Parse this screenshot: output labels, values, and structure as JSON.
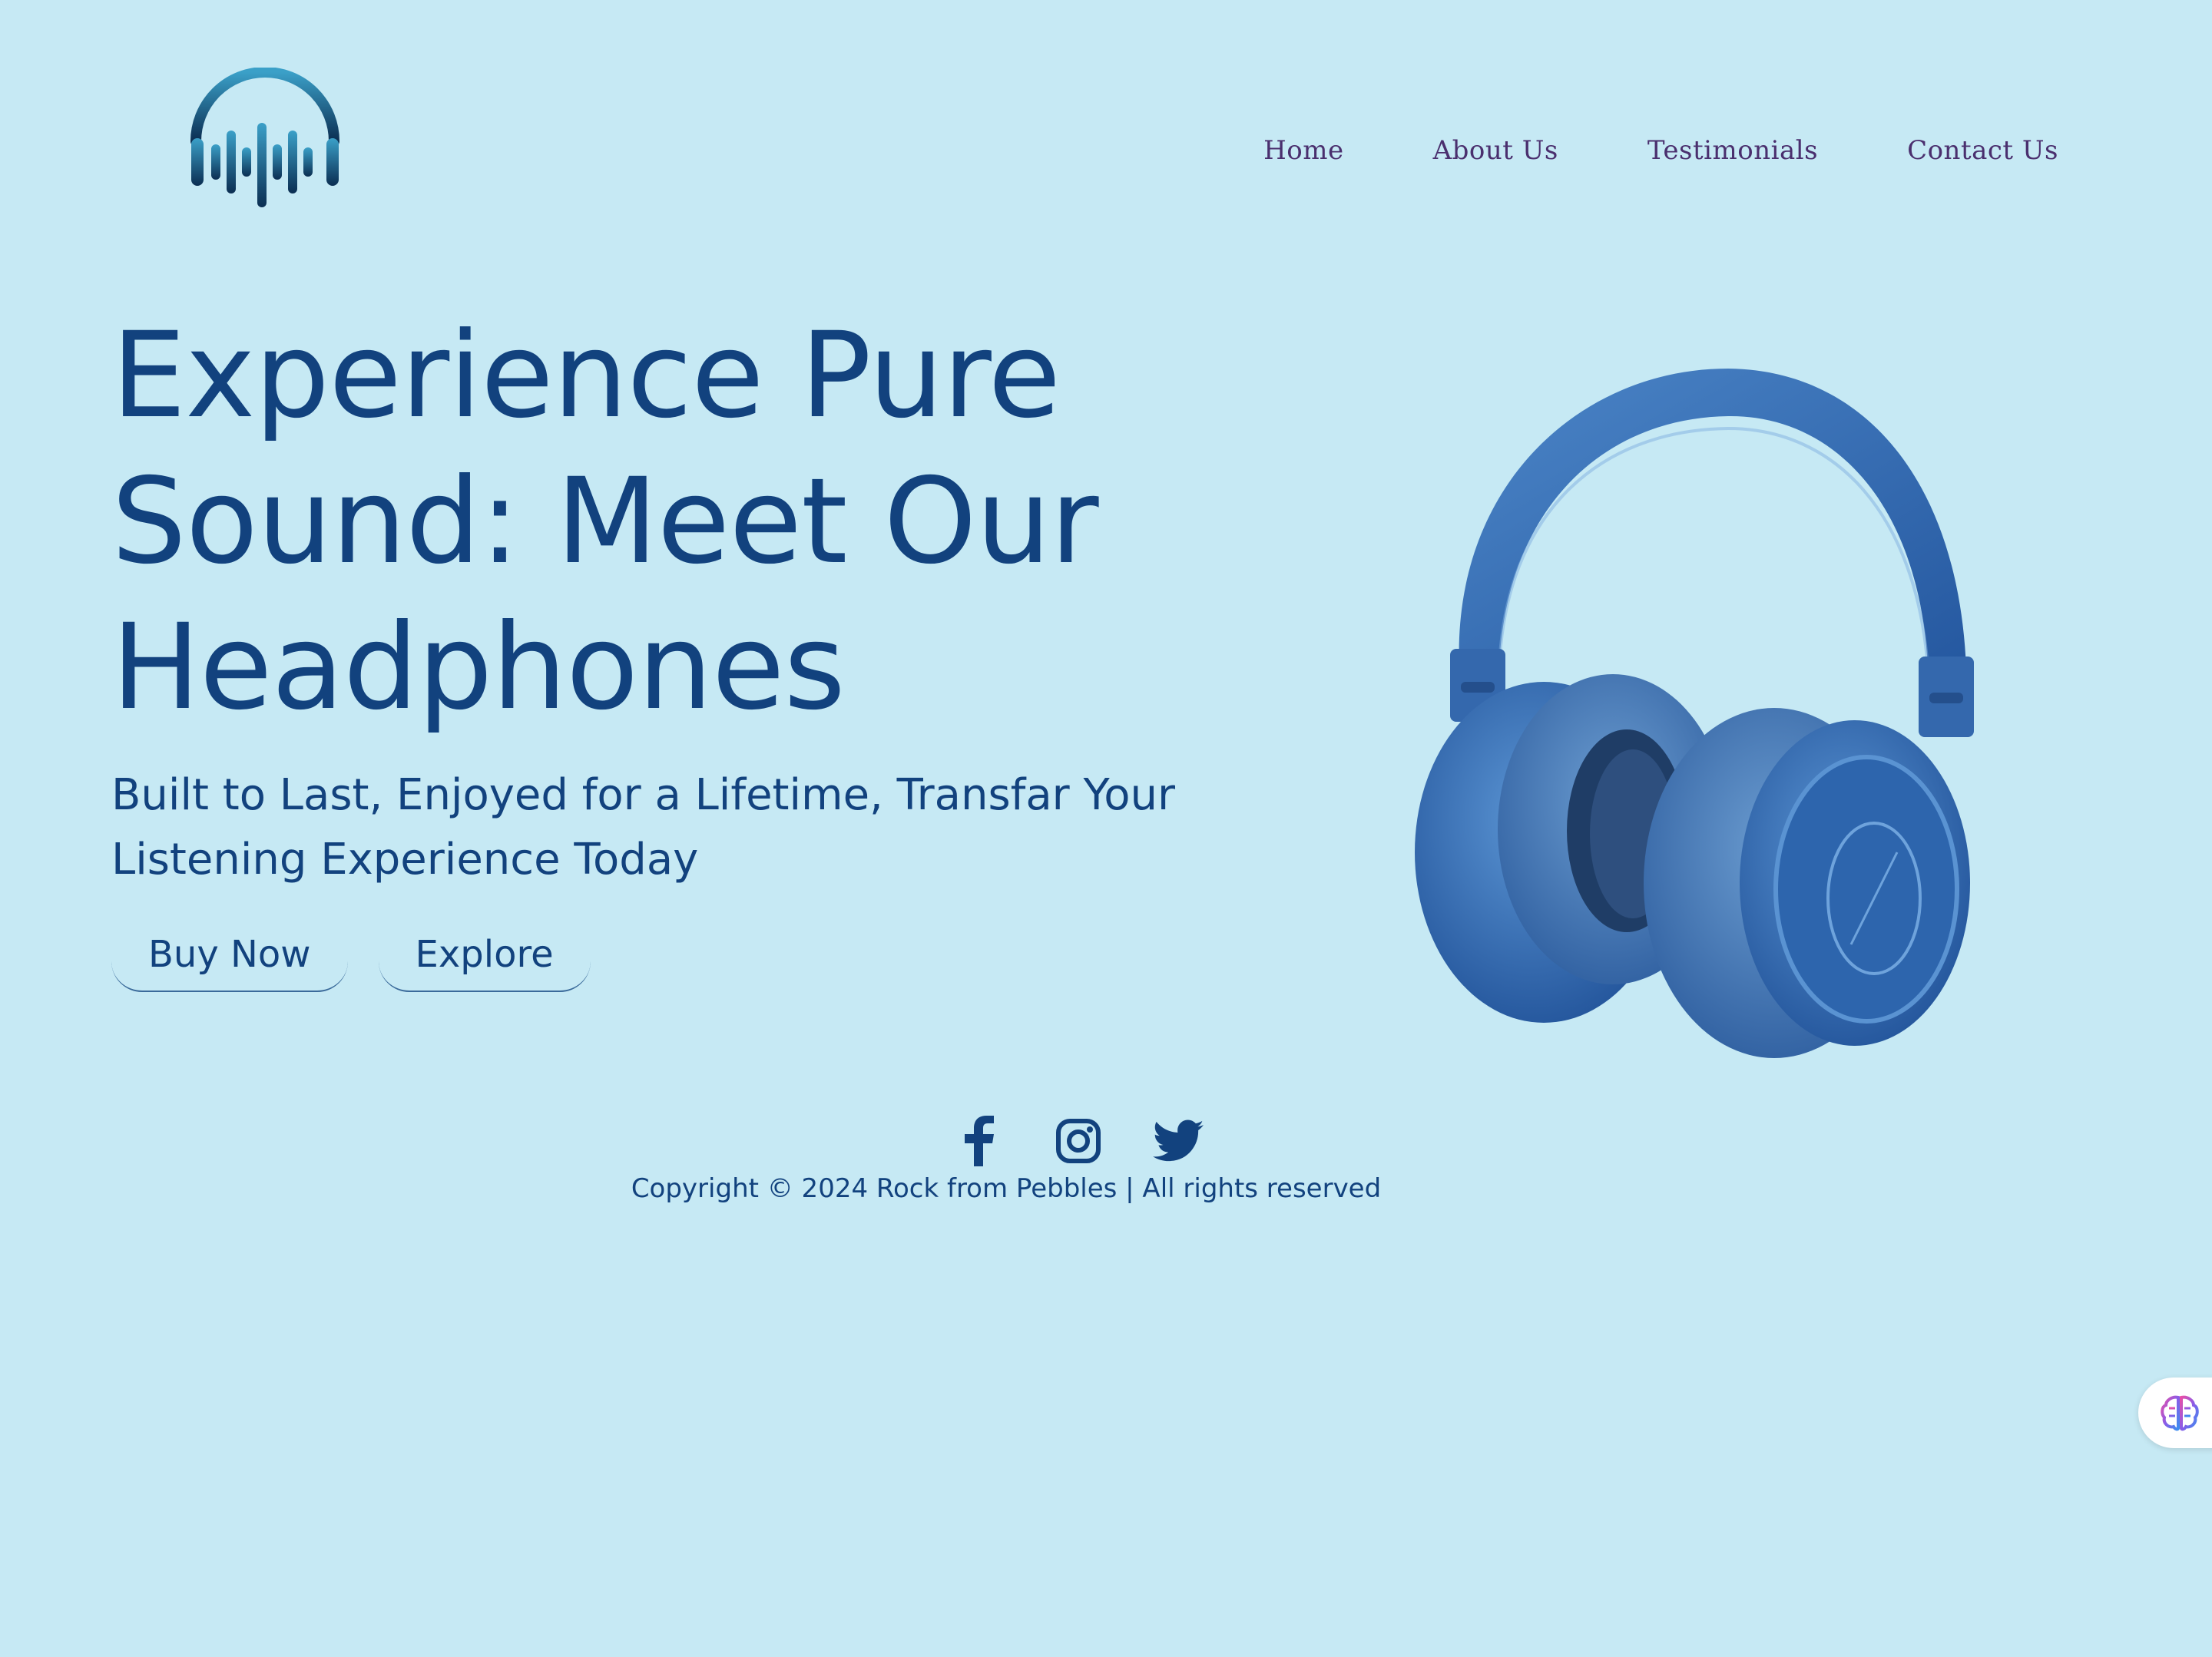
{
  "header": {
    "logo_icon": "headphones-soundwave-logo",
    "nav": [
      {
        "label": "Home"
      },
      {
        "label": "About Us"
      },
      {
        "label": "Testimonials"
      },
      {
        "label": "Contact Us"
      }
    ]
  },
  "hero": {
    "title_line1": "Experience Pure",
    "title_line2": "Sound: Meet Our",
    "title_line3": "Headphones",
    "subtitle_line1": "Built to Last, Enjoyed for a Lifetime, Transfar Your",
    "subtitle_line2": "Listening Experience Today",
    "buttons": [
      {
        "label": "Buy Now"
      },
      {
        "label": "Explore"
      }
    ],
    "image": "blue-headphones-image"
  },
  "footer": {
    "socials": [
      "facebook-icon",
      "instagram-icon",
      "twitter-icon"
    ],
    "copyright": "Copyright © 2024 Rock from Pebbles | All rights reserved"
  },
  "floating": {
    "icon": "brain-icon"
  },
  "colors": {
    "background": "#c6e9f4",
    "primary_text": "#12427e",
    "nav_text": "#4a2f6e"
  }
}
